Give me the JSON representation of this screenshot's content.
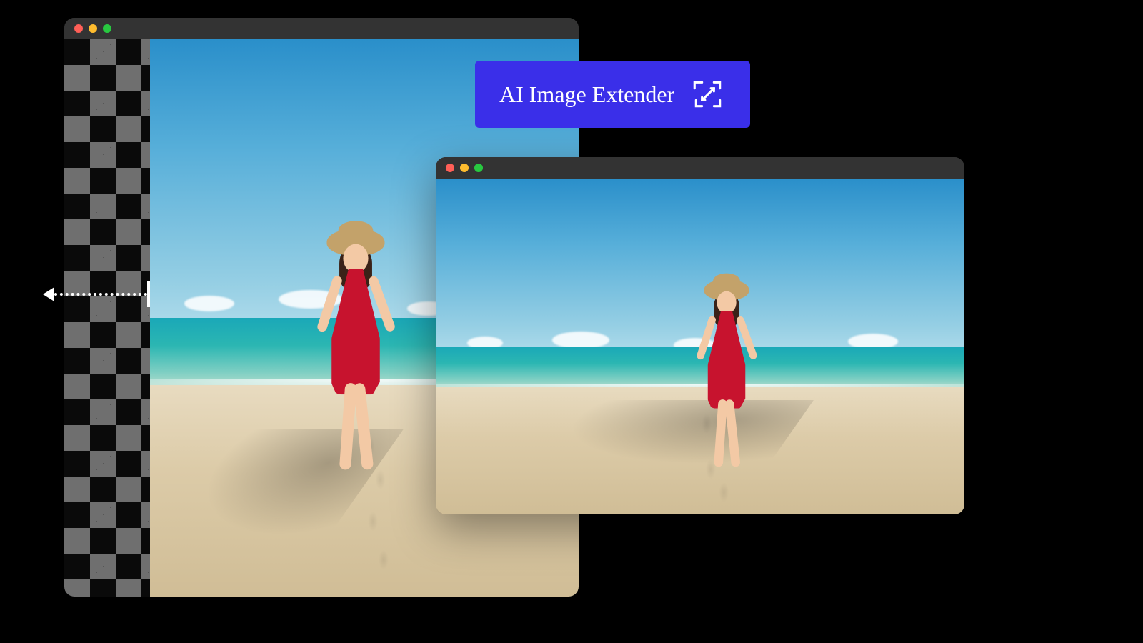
{
  "badge": {
    "label": "AI Image Extender",
    "icon_name": "expand-icon"
  },
  "colors": {
    "badge_bg": "#3a2fe9",
    "titlebar_bg": "#333333",
    "dot_red": "#ff5f57",
    "dot_yellow": "#febc2e",
    "dot_green": "#28c840"
  },
  "back_window": {
    "role": "original-image-with-transparent-extension-area"
  },
  "front_window": {
    "role": "ai-extended-result"
  }
}
